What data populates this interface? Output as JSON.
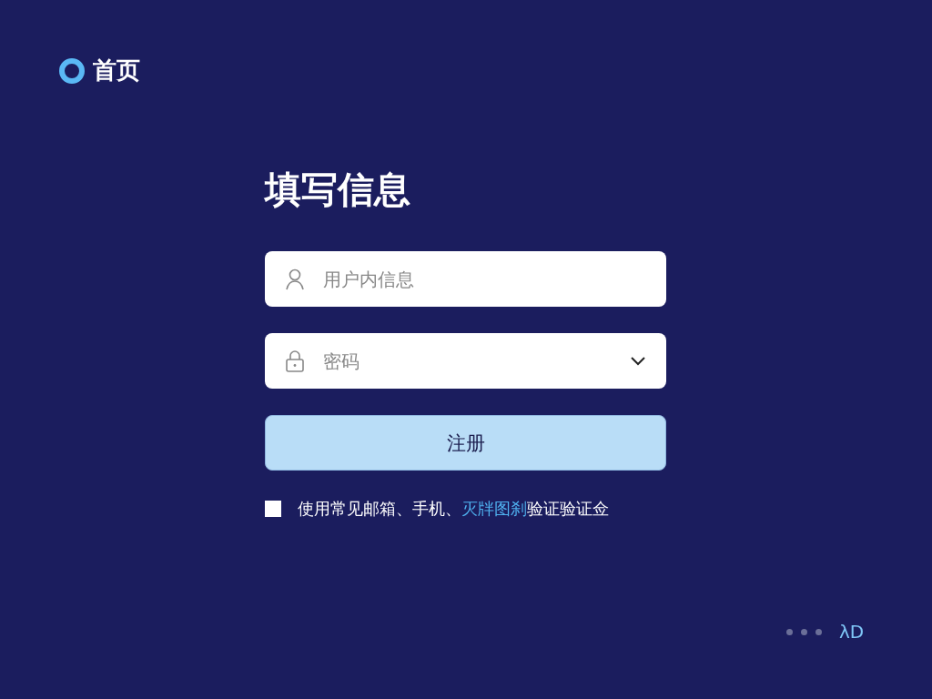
{
  "header": {
    "title": "首页"
  },
  "form": {
    "title": "填写信息",
    "fields": [
      {
        "kind": "text",
        "placeholder": "用户内信息"
      },
      {
        "kind": "select",
        "placeholder": "密码"
      }
    ],
    "submit": "注册",
    "agreement": {
      "checked": false,
      "before": "使用常见邮箱、手机、",
      "link": "灭牉图刹",
      "after": "验证验证佥"
    }
  },
  "footer": {
    "dots": [
      {
        "selected": false
      },
      {
        "selected": false
      },
      {
        "selected": false
      }
    ],
    "label": "λD"
  }
}
